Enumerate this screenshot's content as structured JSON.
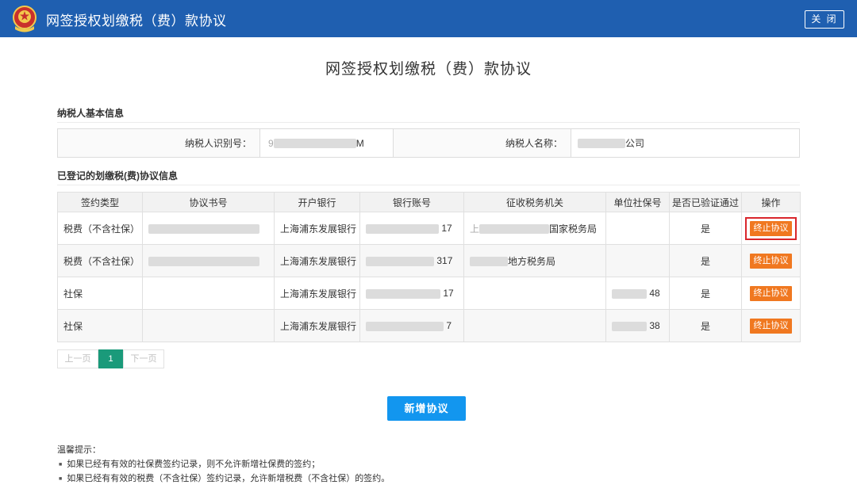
{
  "header": {
    "title": "网签授权划缴税（费）款协议",
    "close_label": "关 闭",
    "bar_color": "#1f5fb0"
  },
  "page_title": "网签授权划缴税（费）款协议",
  "basic_info": {
    "section_title": "纳税人基本信息",
    "taxpayer_id_label": "纳税人识别号：",
    "taxpayer_id_prefix": "9",
    "taxpayer_id_suffix": "M",
    "taxpayer_name_label": "纳税人名称：",
    "taxpayer_name_suffix": "公司"
  },
  "agreements": {
    "section_title": "已登记的划缴税(费)协议信息",
    "columns": [
      "签约类型",
      "协议书号",
      "开户银行",
      "银行账号",
      "征收税务机关",
      "单位社保号",
      "是否已验证通过",
      "操作"
    ],
    "rows": [
      {
        "type": "税费（不含社保）",
        "bank": "上海浦东发展银行",
        "account_suffix": "17",
        "authority_prefix": "上",
        "authority_suffix": "国家税务局",
        "social_suffix": "",
        "verified": "是",
        "action": "终止协议"
      },
      {
        "type": "税费（不含社保）",
        "bank": "上海浦东发展银行",
        "account_suffix": "317",
        "authority_prefix": "",
        "authority_suffix": "地方税务局",
        "social_suffix": "",
        "verified": "是",
        "action": "终止协议"
      },
      {
        "type": "社保",
        "bank": "上海浦东发展银行",
        "account_suffix": "17",
        "authority_prefix": "",
        "authority_suffix": "",
        "social_suffix": "48",
        "verified": "是",
        "action": "终止协议"
      },
      {
        "type": "社保",
        "bank": "上海浦东发展银行",
        "account_suffix": "7",
        "authority_prefix": "",
        "authority_suffix": "",
        "social_suffix": "38",
        "verified": "是",
        "action": "终止协议"
      }
    ]
  },
  "pager": {
    "prev_label": "上一页",
    "current_page": "1",
    "next_label": "下一页"
  },
  "add_button_label": "新增协议",
  "tips": {
    "title": "温馨提示：",
    "items": [
      "如果已经有有效的社保费签约记录，则不允许新增社保费的签约；",
      "如果已经有有效的税费（不含社保）签约记录，允许新增税费（不含社保）的签约。"
    ]
  },
  "colors": {
    "action_button": "#f07820",
    "add_button": "#1296ef",
    "active_page": "#1a9a7a",
    "highlight_frame": "#d9262c"
  }
}
